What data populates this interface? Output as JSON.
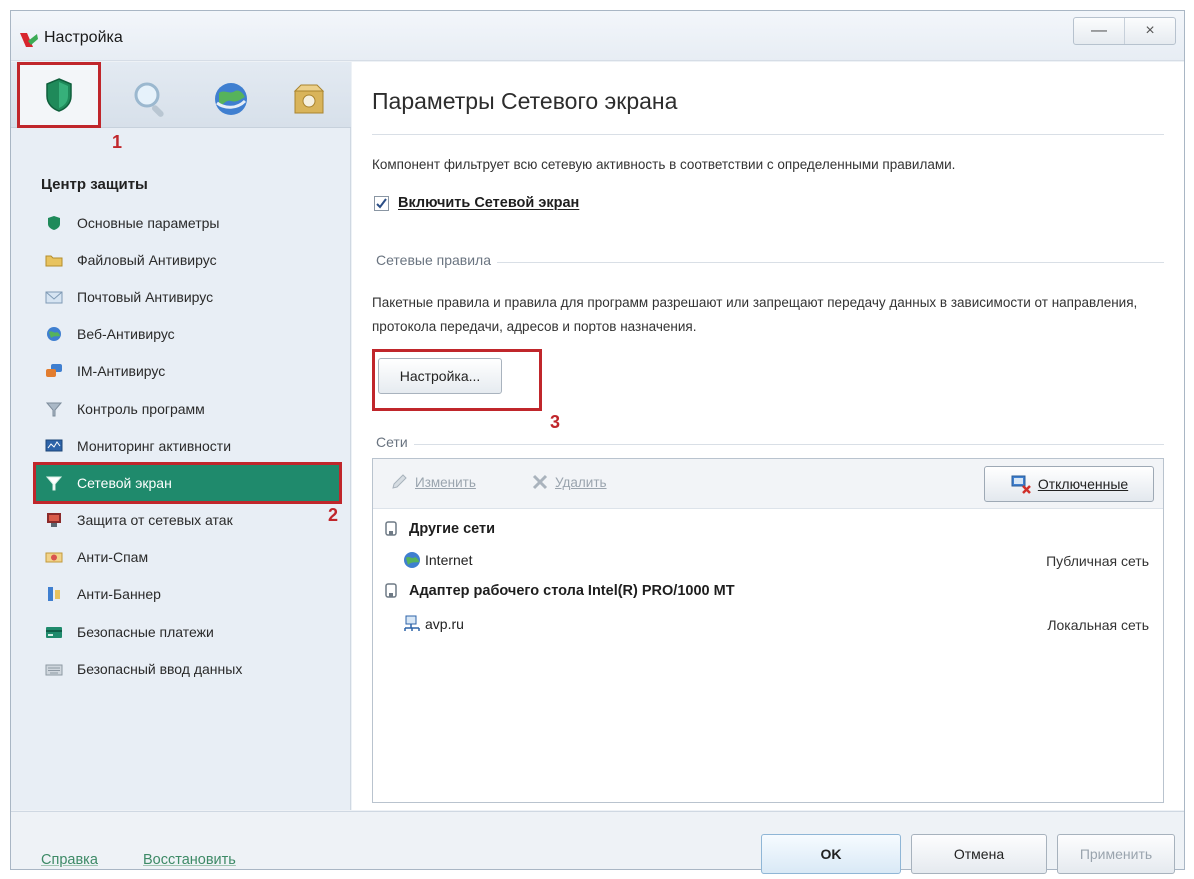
{
  "window": {
    "title": "Настройка",
    "minimize": "—",
    "close": "×"
  },
  "left_tabs": [
    {
      "name": "protection-tab",
      "icon": "shield-icon",
      "active": true
    },
    {
      "name": "scan-tab",
      "icon": "magnifier-icon",
      "active": false
    },
    {
      "name": "update-tab",
      "icon": "globe-icon",
      "active": false
    },
    {
      "name": "settings-tab",
      "icon": "box-icon",
      "active": false
    }
  ],
  "annotations": {
    "one": "1",
    "two": "2",
    "three": "3"
  },
  "sidebar": {
    "title": "Центр защиты",
    "items": [
      {
        "label": "Основные параметры",
        "icon": "shield-icon",
        "active": false
      },
      {
        "label": "Файловый Антивирус",
        "icon": "folder-icon",
        "active": false
      },
      {
        "label": "Почтовый Антивирус",
        "icon": "mail-icon",
        "active": false
      },
      {
        "label": "Веб-Антивирус",
        "icon": "globe-icon",
        "active": false
      },
      {
        "label": "IM-Антивирус",
        "icon": "chat-icon",
        "active": false
      },
      {
        "label": "Контроль программ",
        "icon": "filter-icon",
        "active": false
      },
      {
        "label": "Мониторинг активности",
        "icon": "monitor-icon",
        "active": false
      },
      {
        "label": "Сетевой экран",
        "icon": "firewall-icon",
        "active": true
      },
      {
        "label": "Защита от сетевых атак",
        "icon": "network-attack-icon",
        "active": false
      },
      {
        "label": "Анти-Спам",
        "icon": "spam-icon",
        "active": false
      },
      {
        "label": "Анти-Баннер",
        "icon": "banner-icon",
        "active": false
      },
      {
        "label": "Безопасные платежи",
        "icon": "card-icon",
        "active": false
      },
      {
        "label": "Безопасный ввод данных",
        "icon": "keyboard-icon",
        "active": false
      }
    ]
  },
  "main": {
    "title": "Параметры Сетевого экрана",
    "description": "Компонент фильтрует всю сетевую активность в соответствии с определенными правилами.",
    "enable_checkbox": {
      "label": "Включить Сетевой экран",
      "checked": true
    },
    "rules_group": {
      "label": "Сетевые правила",
      "text": "Пакетные правила и правила для программ разрешают или запрещают передачу данных в зависимости от направления, протокола передачи, адресов и портов назначения.",
      "button": "Настройка..."
    },
    "networks_group": {
      "label": "Сети",
      "toolbar": {
        "edit": "Изменить",
        "delete": "Удалить",
        "disabled": "Отключенные"
      },
      "groups": [
        {
          "label": "Другие сети",
          "entries": [
            {
              "name": "Internet",
              "type": "Публичная сеть",
              "icon": "globe-icon"
            }
          ]
        },
        {
          "label": "Адаптер рабочего стола Intel(R) PRO/1000 MT",
          "entries": [
            {
              "name": "avp.ru",
              "type": "Локальная сеть",
              "icon": "network-icon"
            }
          ]
        }
      ]
    }
  },
  "footer": {
    "help": "Справка",
    "restore": "Восстановить",
    "ok": "OK",
    "cancel": "Отмена",
    "apply": "Применить"
  },
  "colors": {
    "accent": "#1f8a6c",
    "annotation": "#c0262b",
    "link": "#3d8a66"
  }
}
